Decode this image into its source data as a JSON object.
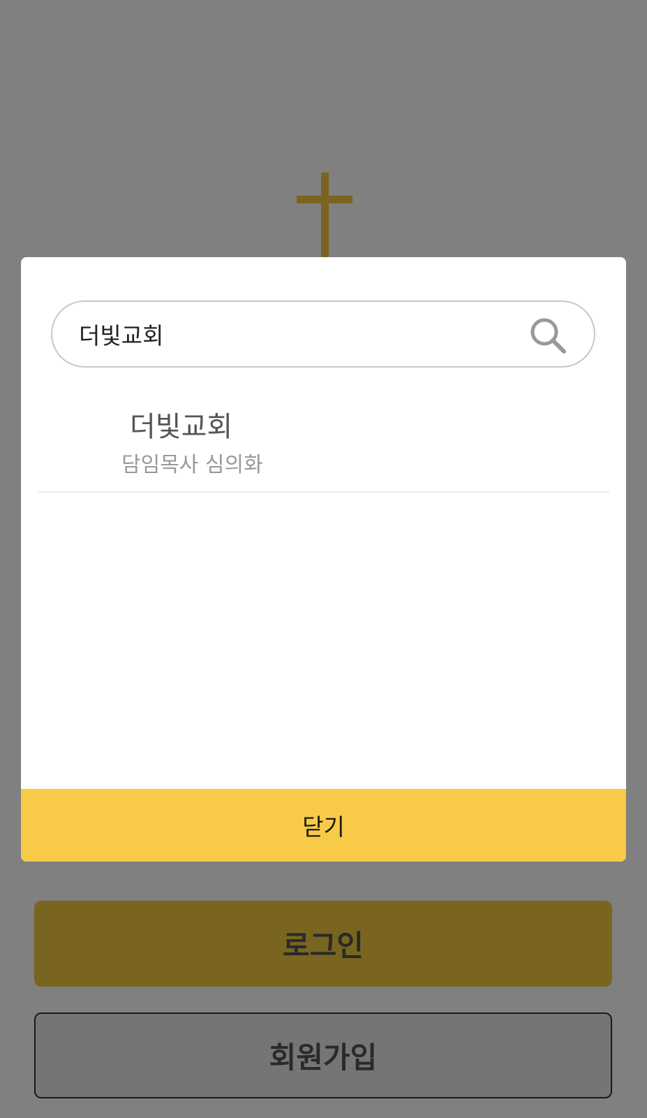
{
  "background": {
    "logo_icon": "cross-icon",
    "login_label": "로그인",
    "signup_label": "회원가입",
    "accent_color": "#7a6520"
  },
  "modal": {
    "search": {
      "value": "더빛교회",
      "icon": "search-icon"
    },
    "results": [
      {
        "name": "더빛교회",
        "subtitle": "담임목사 심의화"
      }
    ],
    "close_label": "닫기",
    "close_color": "#f7cb47"
  }
}
